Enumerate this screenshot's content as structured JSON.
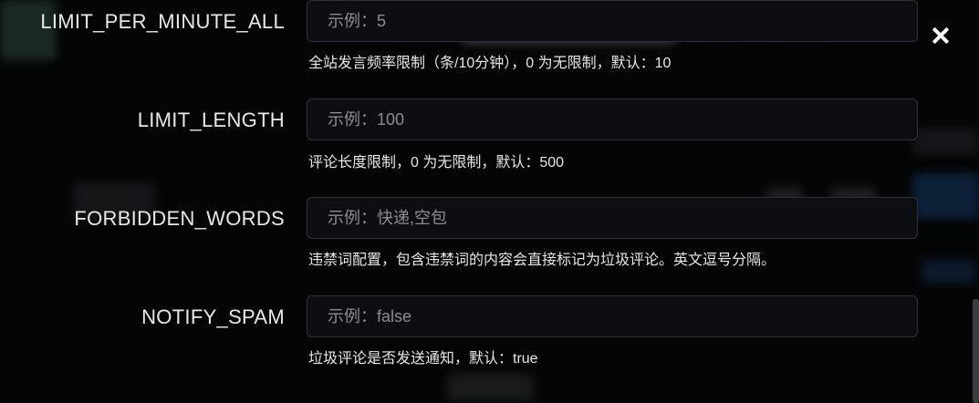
{
  "fields": [
    {
      "label": "LIMIT_PER_MINUTE_ALL",
      "placeholder": "示例：5",
      "value": "",
      "help": "全站发言频率限制（条/10分钟），0 为无限制，默认：10"
    },
    {
      "label": "LIMIT_LENGTH",
      "placeholder": "示例：100",
      "value": "",
      "help": "评论长度限制，0 为无限制，默认：500"
    },
    {
      "label": "FORBIDDEN_WORDS",
      "placeholder": "示例：快递,空包",
      "value": "",
      "help": "违禁词配置，包含违禁词的内容会直接标记为垃圾评论。英文逗号分隔。"
    },
    {
      "label": "NOTIFY_SPAM",
      "placeholder": "示例：false",
      "value": "",
      "help": "垃圾评论是否发送通知，默认：true"
    }
  ],
  "close_icon": "close-icon",
  "colors": {
    "overlay": "#000000b8",
    "text": "#e8e8e8",
    "input_border": "#2f3338",
    "placeholder": "#8a8d91"
  }
}
